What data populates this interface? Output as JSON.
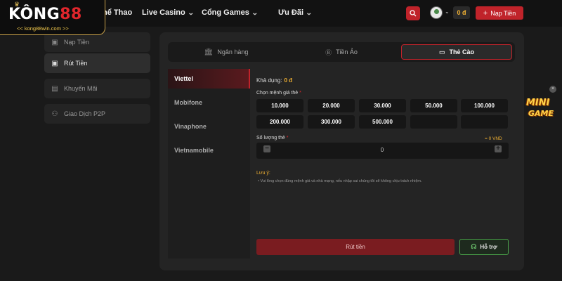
{
  "brand": {
    "name_white": "KÔNG",
    "name_red": "88",
    "sub": "<< kong88win.com >>"
  },
  "nav": {
    "items": [
      {
        "label": "hể Thao",
        "chevron": false
      },
      {
        "label": "Live Casino",
        "chevron": true
      },
      {
        "label": "Cổng Games",
        "chevron": true
      },
      {
        "label": "Ưu Đãi",
        "chevron": true
      }
    ],
    "balance": "0 đ",
    "deposit_label": "Nạp Tiền",
    "icons": {
      "search": "search-icon",
      "avatar": "user-avatar",
      "deposit": "plus-icon"
    }
  },
  "sidebar": {
    "items": [
      {
        "label": "Nạp Tiền",
        "icon": "deposit-icon",
        "active": false
      },
      {
        "label": "Rút Tiền",
        "icon": "withdraw-icon",
        "active": true
      },
      {
        "label": "Khuyến Mãi",
        "icon": "gift-icon",
        "active": false
      },
      {
        "label": "Giao Dịch P2P",
        "icon": "p2p-icon",
        "active": false
      }
    ]
  },
  "tabs": [
    {
      "label": "Ngân hàng",
      "icon": "bank-icon",
      "active": false
    },
    {
      "label": "Tiền Ảo",
      "icon": "crypto-icon",
      "active": false
    },
    {
      "label": "Thẻ Cào",
      "icon": "card-icon",
      "active": true
    }
  ],
  "providers": [
    {
      "label": "Viettel",
      "active": true
    },
    {
      "label": "Mobifone",
      "active": false
    },
    {
      "label": "Vinaphone",
      "active": false
    },
    {
      "label": "Vietnamobile",
      "active": false
    }
  ],
  "form": {
    "available_label": "Khả dụng:",
    "available_value": "0 đ",
    "denomination_label": "Chọn mệnh giá thẻ",
    "required_mark": "*",
    "amounts": [
      "10.000",
      "20.000",
      "30.000",
      "50.000",
      "100.000",
      "200.000",
      "300.000",
      "500.000",
      "",
      ""
    ],
    "quantity_label": "Số lượng thẻ",
    "quantity_total": "= 0 VND",
    "quantity_value": "0",
    "note_title": "Lưu ý:",
    "note_text": "•  Vui lòng chọn đúng mệnh giá và nhà mạng, nếu nhập sai chúng tôi sẽ không chịu trách nhiệm.",
    "withdraw_label": "Rút tiền",
    "support_label": "Hỗ trợ"
  },
  "mini_game": {
    "line1": "MINI",
    "line2": "GAME",
    "close": "×"
  },
  "colors": {
    "accent": "#c0232a",
    "gold": "#f2b233",
    "support": "#4aa34a"
  }
}
